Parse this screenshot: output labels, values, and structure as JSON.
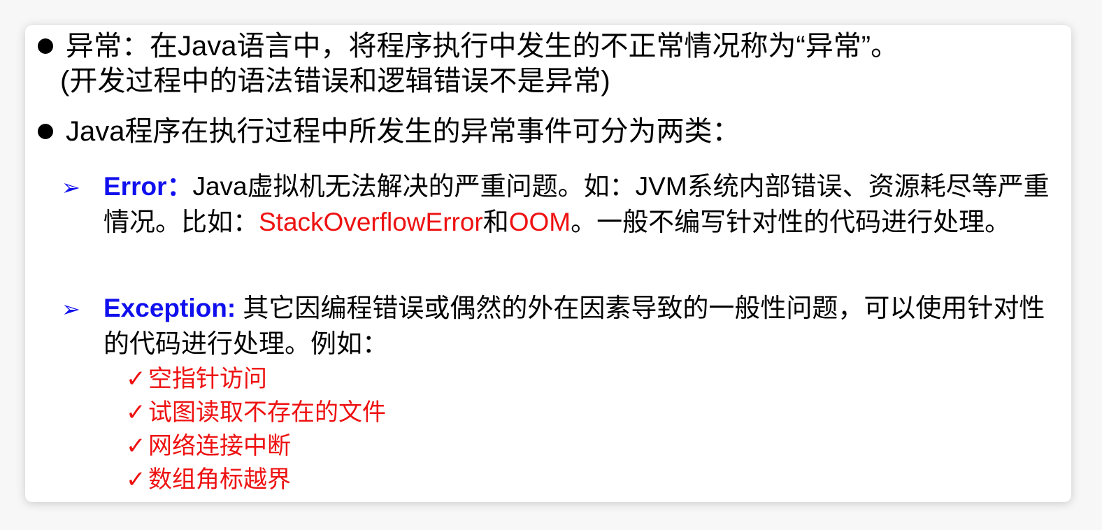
{
  "bullets": [
    {
      "line1": "异常：在Java语言中，将程序执行中发生的不正常情况称为“异常”。",
      "line2": "(开发过程中的语法错误和逻辑错误不是异常)"
    },
    {
      "line1": "Java程序在执行过程中所发生的异常事件可分为两类："
    }
  ],
  "sub_items": [
    {
      "marker": "➢",
      "head": "Error：",
      "text_a": "Java虚拟机无法解决的严重问题。如：JVM系统内部错误、资源耗尽等严重情况。比如：",
      "red_a": "StackOverflowError",
      "text_b": "和",
      "red_b": "OOM",
      "text_c": "。一般不编写针对性的代码进行处理。"
    },
    {
      "marker": "➢",
      "head": "Exception:",
      "text_a": " 其它因编程错误或偶然的外在因素导致的一般性问题，可以使用针对性的代码进行处理。例如："
    }
  ],
  "examples": [
    {
      "mark": "✓",
      "text": "空指针访问"
    },
    {
      "mark": "✓",
      "text": "试图读取不存在的文件"
    },
    {
      "mark": "✓",
      "text": "网络连接中断"
    },
    {
      "mark": "✓",
      "text": "数组角标越界"
    }
  ]
}
